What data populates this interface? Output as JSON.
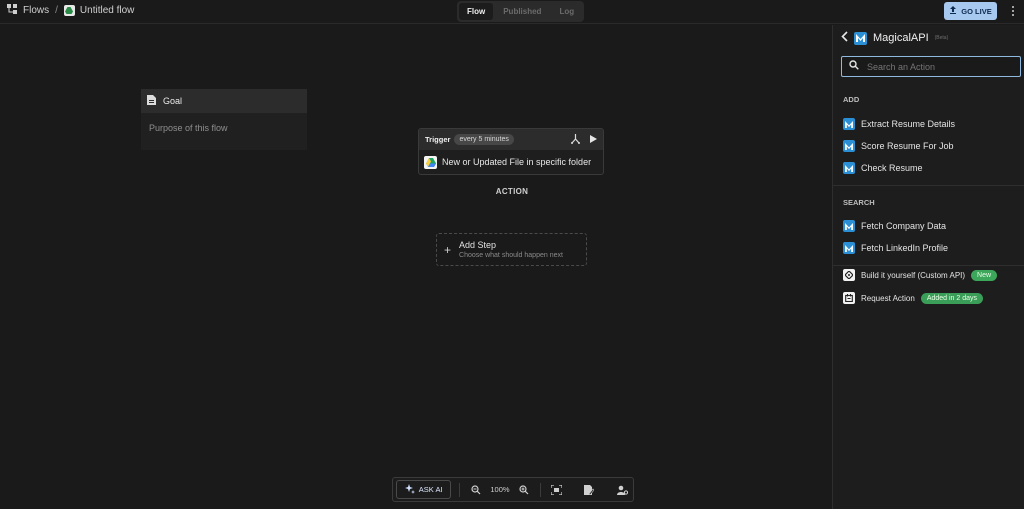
{
  "topbar": {
    "breadcrumb_root": "Flows",
    "breadcrumb_sep": "/",
    "flow_name": "Untitled flow",
    "tabs": [
      {
        "label": "Flow",
        "active": true
      },
      {
        "label": "Published",
        "active": false
      },
      {
        "label": "Log",
        "active": false
      }
    ],
    "go_live": "GO LIVE"
  },
  "canvas": {
    "goal": {
      "title": "Goal",
      "placeholder": "Purpose of this flow"
    },
    "trigger": {
      "label": "Trigger",
      "interval": "every 5 minutes",
      "event": "New or Updated File in specific folder"
    },
    "action_label": "ACTION",
    "add_step": {
      "title": "Add Step",
      "subtitle": "Choose what should happen next"
    }
  },
  "toolbar": {
    "ask_ai": "ASK AI",
    "zoom": "100%"
  },
  "panel": {
    "title": "MagicalAPI",
    "tag": "(Beta)",
    "search_placeholder": "Search an Action",
    "add_section": "ADD",
    "add_items": [
      "Extract Resume Details",
      "Score Resume For Job",
      "Check Resume"
    ],
    "search_section": "SEARCH",
    "search_items": [
      "Fetch Company Data",
      "Fetch LinkedIn Profile"
    ],
    "extras": [
      {
        "label": "Build it yourself (Custom API)",
        "badge": "New"
      },
      {
        "label": "Request Action",
        "badge": "Added in 2 days"
      }
    ]
  },
  "colors": {
    "accent": "#2b8fd6",
    "go_live_bg": "#a7c8ef",
    "badge_green": "#3ca65a"
  }
}
